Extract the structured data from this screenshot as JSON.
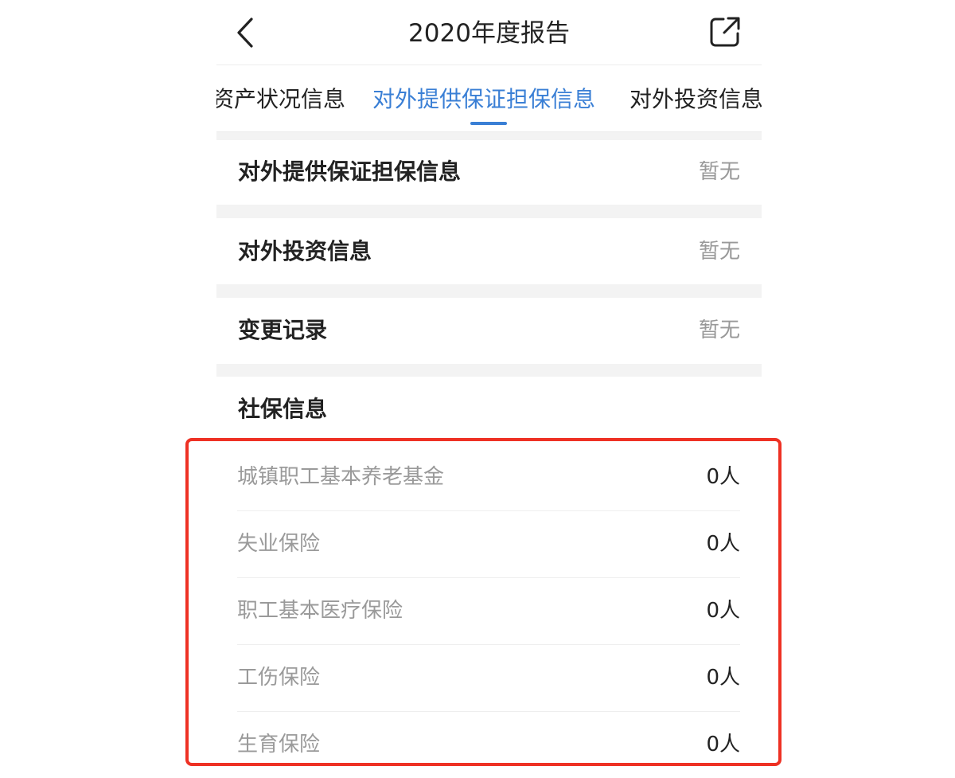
{
  "header": {
    "title": "2020年度报告"
  },
  "tabs": [
    {
      "label": "资产状况信息",
      "active": false
    },
    {
      "label": "对外提供保证担保信息",
      "active": true
    },
    {
      "label": "对外投资信息",
      "active": false
    }
  ],
  "sections": [
    {
      "title": "对外提供保证担保信息",
      "value": "暂无"
    },
    {
      "title": "对外投资信息",
      "value": "暂无"
    },
    {
      "title": "变更记录",
      "value": "暂无"
    }
  ],
  "social_insurance": {
    "title": "社保信息",
    "items": [
      {
        "label": "城镇职工基本养老基金",
        "value": "0人"
      },
      {
        "label": "失业保险",
        "value": "0人"
      },
      {
        "label": "职工基本医疗保险",
        "value": "0人"
      },
      {
        "label": "工伤保险",
        "value": "0人"
      },
      {
        "label": "生育保险",
        "value": "0人"
      }
    ]
  },
  "colors": {
    "accent": "#3a7fd5",
    "highlight": "#ee3124",
    "muted_text": "#999999",
    "divider_bg": "#f3f3f3"
  },
  "icons": {
    "back": "chevron-left-icon",
    "share": "share-external-icon"
  }
}
